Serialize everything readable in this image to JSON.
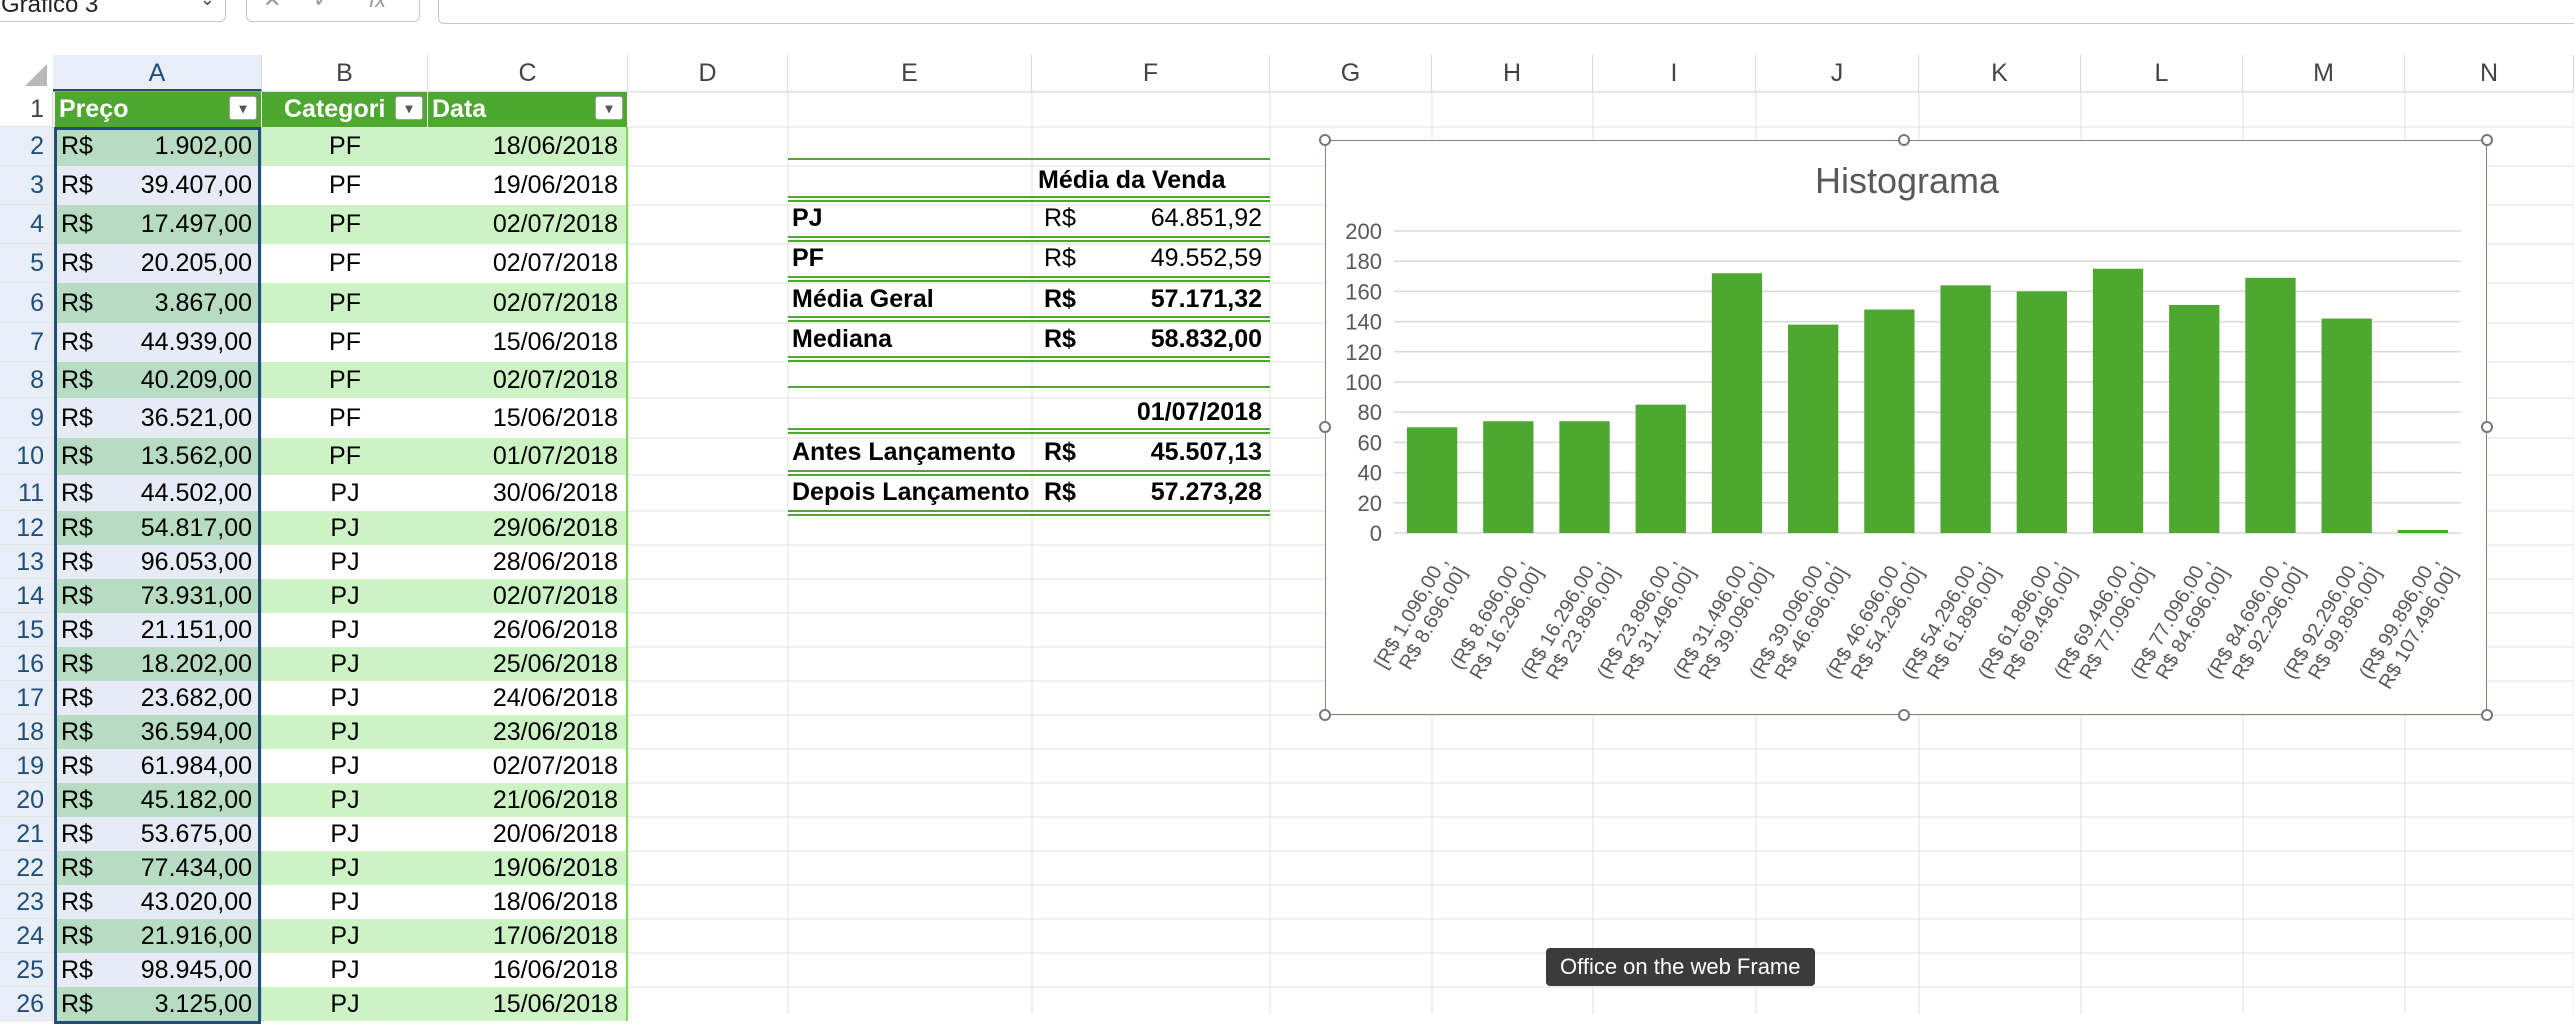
{
  "formula_bar": {
    "name_box": "Gráfico 3",
    "fx_label": "fx"
  },
  "columns": [
    "A",
    "B",
    "C",
    "D",
    "E",
    "F",
    "G",
    "H",
    "I",
    "J",
    "K",
    "L",
    "M",
    "N"
  ],
  "rows": [
    "1",
    "2",
    "3",
    "4",
    "5",
    "6",
    "7",
    "8",
    "9",
    "10",
    "11",
    "12",
    "13",
    "14",
    "15",
    "16",
    "17",
    "18",
    "19",
    "20",
    "21",
    "22",
    "23",
    "24",
    "25",
    "26"
  ],
  "table": {
    "headers": [
      "Preço",
      "Categori",
      "Data"
    ],
    "currency": "R$",
    "rows": [
      {
        "preco": "1.902,00",
        "cat": "PF",
        "data": "18/06/2018"
      },
      {
        "preco": "39.407,00",
        "cat": "PF",
        "data": "19/06/2018"
      },
      {
        "preco": "17.497,00",
        "cat": "PF",
        "data": "02/07/2018"
      },
      {
        "preco": "20.205,00",
        "cat": "PF",
        "data": "02/07/2018"
      },
      {
        "preco": "3.867,00",
        "cat": "PF",
        "data": "02/07/2018"
      },
      {
        "preco": "44.939,00",
        "cat": "PF",
        "data": "15/06/2018"
      },
      {
        "preco": "40.209,00",
        "cat": "PF",
        "data": "02/07/2018"
      },
      {
        "preco": "36.521,00",
        "cat": "PF",
        "data": "15/06/2018"
      },
      {
        "preco": "13.562,00",
        "cat": "PF",
        "data": "01/07/2018"
      },
      {
        "preco": "44.502,00",
        "cat": "PJ",
        "data": "30/06/2018"
      },
      {
        "preco": "54.817,00",
        "cat": "PJ",
        "data": "29/06/2018"
      },
      {
        "preco": "96.053,00",
        "cat": "PJ",
        "data": "28/06/2018"
      },
      {
        "preco": "73.931,00",
        "cat": "PJ",
        "data": "02/07/2018"
      },
      {
        "preco": "21.151,00",
        "cat": "PJ",
        "data": "26/06/2018"
      },
      {
        "preco": "18.202,00",
        "cat": "PJ",
        "data": "25/06/2018"
      },
      {
        "preco": "23.682,00",
        "cat": "PJ",
        "data": "24/06/2018"
      },
      {
        "preco": "36.594,00",
        "cat": "PJ",
        "data": "23/06/2018"
      },
      {
        "preco": "61.984,00",
        "cat": "PJ",
        "data": "02/07/2018"
      },
      {
        "preco": "45.182,00",
        "cat": "PJ",
        "data": "21/06/2018"
      },
      {
        "preco": "53.675,00",
        "cat": "PJ",
        "data": "20/06/2018"
      },
      {
        "preco": "77.434,00",
        "cat": "PJ",
        "data": "19/06/2018"
      },
      {
        "preco": "43.020,00",
        "cat": "PJ",
        "data": "18/06/2018"
      },
      {
        "preco": "21.916,00",
        "cat": "PJ",
        "data": "17/06/2018"
      },
      {
        "preco": "98.945,00",
        "cat": "PJ",
        "data": "16/06/2018"
      },
      {
        "preco": "3.125,00",
        "cat": "PJ",
        "data": "15/06/2018"
      }
    ]
  },
  "summary": {
    "header": "Média da Venda",
    "pj_label": "PJ",
    "pj_cur": "R$",
    "pj_value": "64.851,92",
    "pf_label": "PF",
    "pf_cur": "R$",
    "pf_value": "49.552,59",
    "geral_label": "Média Geral",
    "geral_cur": "R$",
    "geral_value": "57.171,32",
    "mediana_label": "Mediana",
    "mediana_cur": "R$",
    "mediana_value": "58.832,00",
    "launch_date": "01/07/2018",
    "antes_label": "Antes Lançamento",
    "antes_cur": "R$",
    "antes_value": "45.507,13",
    "depois_label": "Depois Lançamento",
    "depois_cur": "R$",
    "depois_value": "57.273,28"
  },
  "chart_data": {
    "type": "bar",
    "title": "Histograma",
    "xlabel": "",
    "ylabel": "",
    "ylim": [
      0,
      200
    ],
    "yticks": [
      0,
      20,
      40,
      60,
      80,
      100,
      120,
      140,
      160,
      180,
      200
    ],
    "grid": true,
    "color": "#4ea72e",
    "categories": [
      [
        "[R$ 1.096,00 ,",
        "R$ 8.696,00]"
      ],
      [
        "(R$ 8.696,00 ,",
        "R$ 16.296,00]"
      ],
      [
        "(R$ 16.296,00 ,",
        "R$ 23.896,00]"
      ],
      [
        "(R$ 23.896,00 ,",
        "R$ 31.496,00]"
      ],
      [
        "(R$ 31.496,00 ,",
        "R$ 39.096,00]"
      ],
      [
        "(R$ 39.096,00 ,",
        "R$ 46.696,00]"
      ],
      [
        "(R$ 46.696,00 ,",
        "R$ 54.296,00]"
      ],
      [
        "(R$ 54.296,00 ,",
        "R$ 61.896,00]"
      ],
      [
        "(R$ 61.896,00 ,",
        "R$ 69.496,00]"
      ],
      [
        "(R$ 69.496,00 ,",
        "R$ 77.096,00]"
      ],
      [
        "(R$ 77.096,00 ,",
        "R$ 84.696,00]"
      ],
      [
        "(R$ 84.696,00 ,",
        "R$ 92.296,00]"
      ],
      [
        "(R$ 92.296,00 ,",
        "R$ 99.896,00]"
      ],
      [
        "(R$ 99.896,00 ,",
        "R$ 107.496,00]"
      ]
    ],
    "values": [
      70,
      74,
      74,
      85,
      172,
      138,
      148,
      164,
      160,
      175,
      151,
      169,
      142,
      2
    ]
  },
  "tooltip": "Office on the web Frame"
}
